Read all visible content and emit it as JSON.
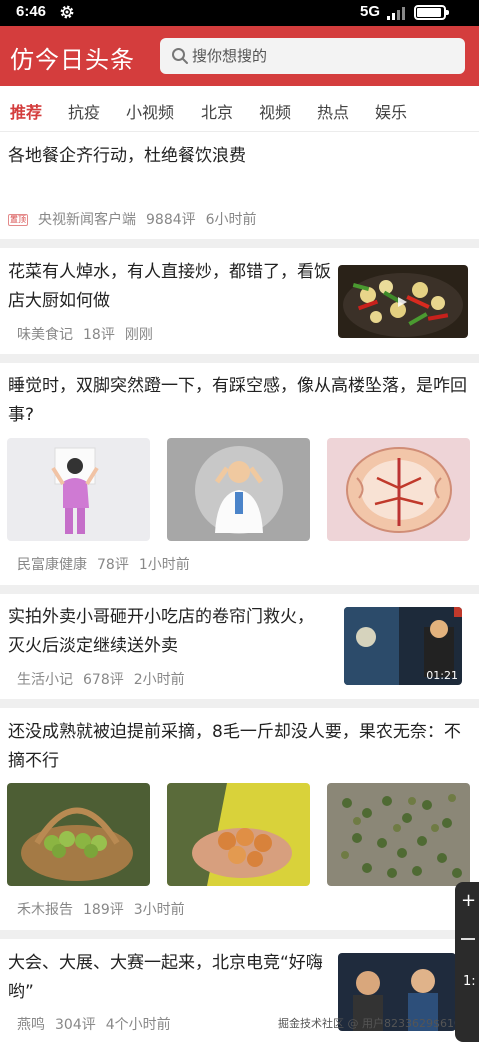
{
  "status_bar": {
    "time": "6:46",
    "network": "5G"
  },
  "header": {
    "app_title": "仿今日头条",
    "search_placeholder": "搜你想搜的",
    "accent_color": "#d43d3d"
  },
  "tabs": [
    {
      "label": "推荐",
      "active": true
    },
    {
      "label": "抗疫",
      "active": false
    },
    {
      "label": "小视频",
      "active": false
    },
    {
      "label": "北京",
      "active": false
    },
    {
      "label": "视频",
      "active": false
    },
    {
      "label": "热点",
      "active": false
    },
    {
      "label": "娱乐",
      "active": false
    }
  ],
  "articles": [
    {
      "title": "各地餐企齐行动，杜绝餐饮浪费",
      "badge": "置顶",
      "source": "央视新闻客户端",
      "comments": "9884评",
      "time": "6小时前"
    },
    {
      "title": "花菜有人焯水，有人直接炒，都错了，看饭店大厨如何做",
      "source": "味美食记",
      "comments": "18评",
      "time": "刚刚"
    },
    {
      "title": "睡觉时，双脚突然蹬一下，有踩空感，像从高楼坠落，是咋回事?",
      "source": "民富康健康",
      "comments": "78评",
      "time": "1小时前"
    },
    {
      "title": "实拍外卖小哥砸开小吃店的卷帘门救火，灭火后淡定继续送外卖",
      "source": "生活小记",
      "comments": "678评",
      "time": "2小时前",
      "duration": "01:21"
    },
    {
      "title": "还没成熟就被迫提前采摘，8毛一斤却没人要，果农无奈：不摘不行",
      "source": "禾木报告",
      "comments": "189评",
      "time": "3小时前"
    },
    {
      "title": "大会、大展、大赛一起来，北京电竞“好嗨哟”",
      "source": "燕鸣",
      "comments": "304评",
      "time": "4个小时前"
    }
  ],
  "watermark": "掘金技术社区 @ 用户8233629$610",
  "floating_panel": {
    "plus": "+",
    "text": "1:"
  }
}
